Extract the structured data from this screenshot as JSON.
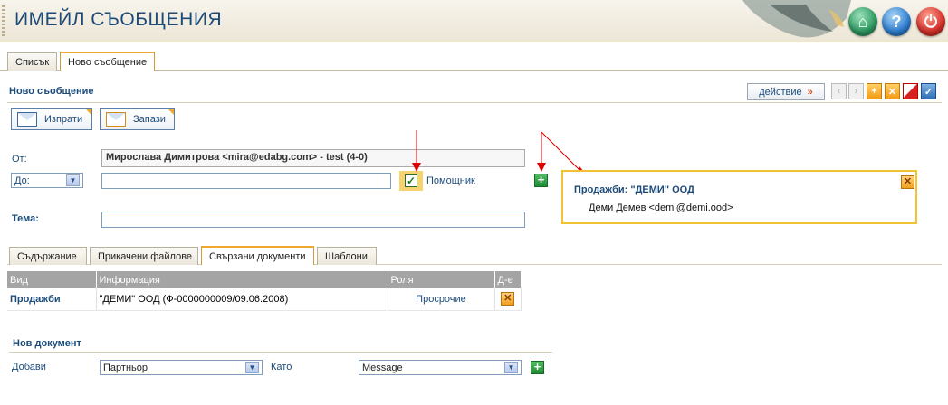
{
  "app": {
    "title": "ИМЕЙЛ СЪОБЩЕНИЯ"
  },
  "main_tabs": [
    {
      "label": "Списък"
    },
    {
      "label": "Ново съобщение"
    }
  ],
  "section": {
    "title": "Ново съобщение"
  },
  "toolbar": {
    "action_label": "действие",
    "action_arrow": "»",
    "send_label": "Изпрати",
    "save_label": "Запази"
  },
  "form": {
    "from_label": "От:",
    "from_value": "Мирослава Димитрова <mira@edabg.com> - test (4-0)",
    "to_select": "До:",
    "to_value": "",
    "helper_label": "Помощник",
    "subject_label": "Тема:",
    "subject_value": ""
  },
  "popup": {
    "title": "Продажби: \"ДЕМИ\" ООД",
    "contact": "Деми Демев <demi@demi.ood>"
  },
  "sub_tabs": [
    {
      "label": "Съдържание"
    },
    {
      "label": "Прикачени файлове"
    },
    {
      "label": "Свързани документи"
    },
    {
      "label": "Шаблони"
    }
  ],
  "docs_table": {
    "headers": [
      "Вид",
      "Информация",
      "Роля",
      "Д-е"
    ],
    "rows": [
      {
        "type": "Продажби",
        "info": "\"ДЕМИ\" ООД (Ф-0000000009/09.06.2008)",
        "role": "Просрочие"
      }
    ]
  },
  "new_doc": {
    "title": "Нов документ",
    "add_label": "Добави",
    "partner_select": "Партньор",
    "as_label": "Като",
    "type_select": "Message"
  },
  "colors": {
    "accent": "#1c4b7a",
    "highlight": "#f1c232",
    "arrow": "#e00000"
  }
}
